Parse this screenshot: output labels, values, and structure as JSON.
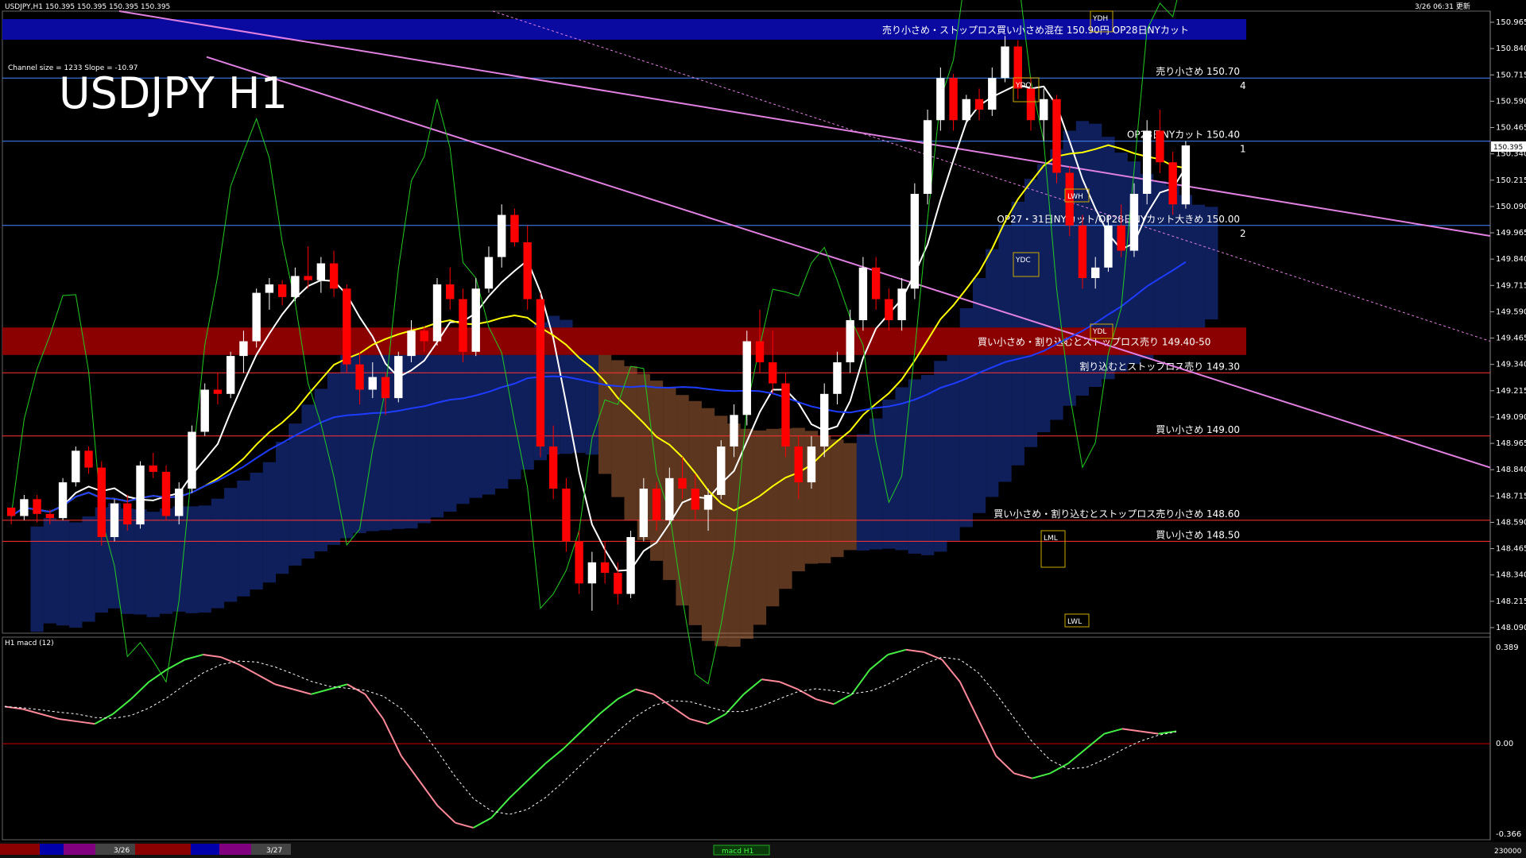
{
  "header": {
    "symbol_info": "USDJPY,H1   150.395 150.395 150.395 150.395",
    "timestamp": "3/26 06:31 更新",
    "channel_info": "Channel size = 1233 Slope = -10.97",
    "chart_title": "USDJPY H1"
  },
  "current_price": "150.395",
  "indicator_label": "H1  macd (12)",
  "bottom_tabs": [
    "3/26",
    "3/27"
  ],
  "bottom_status": "macd H1",
  "bottom_right_value": "230000",
  "colors": {
    "background": "#000000",
    "bull": "#ffffff",
    "bear": "#ff0000",
    "ma_fast": "#ffffff",
    "ma_mid": "#ffff00",
    "ma_slow": "#1e3cff",
    "chikou": "#22cc22",
    "channel": "#e080e0",
    "cloud_bull": "#2244cc",
    "cloud_bear": "#cc7744"
  },
  "chart_data": {
    "type": "candlestick",
    "title": "USDJPY H1",
    "ylim": [
      148.09,
      150.965
    ],
    "y_ticks": [
      "150.965",
      "150.840",
      "150.715",
      "150.590",
      "150.465",
      "150.340",
      "150.215",
      "150.090",
      "149.965",
      "149.840",
      "149.715",
      "149.590",
      "149.465",
      "149.340",
      "149.215",
      "149.090",
      "148.965",
      "148.840",
      "148.715",
      "148.590",
      "148.465",
      "148.340",
      "148.215",
      "148.090"
    ],
    "macd_ticks": [
      "0.389",
      "0.00",
      "-0.366"
    ],
    "candles": [
      [
        148.66,
        148.66,
        148.58,
        148.62
      ],
      [
        148.62,
        148.72,
        148.6,
        148.7
      ],
      [
        148.7,
        148.72,
        148.59,
        148.63
      ],
      [
        148.63,
        148.65,
        148.58,
        148.61
      ],
      [
        148.61,
        148.8,
        148.6,
        148.78
      ],
      [
        148.78,
        148.95,
        148.76,
        148.93
      ],
      [
        148.93,
        148.95,
        148.82,
        148.85
      ],
      [
        148.85,
        148.88,
        148.48,
        148.52
      ],
      [
        148.52,
        148.7,
        148.5,
        148.68
      ],
      [
        148.68,
        148.72,
        148.55,
        148.58
      ],
      [
        148.58,
        148.88,
        148.56,
        148.86
      ],
      [
        148.86,
        148.92,
        148.8,
        148.83
      ],
      [
        148.83,
        148.86,
        148.6,
        148.62
      ],
      [
        148.62,
        148.78,
        148.58,
        148.75
      ],
      [
        148.75,
        149.05,
        148.73,
        149.02
      ],
      [
        149.02,
        149.25,
        149.0,
        149.22
      ],
      [
        149.22,
        149.3,
        149.15,
        149.2
      ],
      [
        149.2,
        149.4,
        149.18,
        149.38
      ],
      [
        149.38,
        149.5,
        149.3,
        149.45
      ],
      [
        149.45,
        149.7,
        149.42,
        149.68
      ],
      [
        149.68,
        149.75,
        149.6,
        149.72
      ],
      [
        149.72,
        149.74,
        149.62,
        149.66
      ],
      [
        149.66,
        149.8,
        149.64,
        149.76
      ],
      [
        149.76,
        149.9,
        149.7,
        149.74
      ],
      [
        149.74,
        149.85,
        149.68,
        149.82
      ],
      [
        149.82,
        149.88,
        149.66,
        149.7
      ],
      [
        149.7,
        149.72,
        149.3,
        149.34
      ],
      [
        149.34,
        149.4,
        149.15,
        149.22
      ],
      [
        149.22,
        149.35,
        149.18,
        149.28
      ],
      [
        149.28,
        149.3,
        149.1,
        149.18
      ],
      [
        149.18,
        149.4,
        149.16,
        149.38
      ],
      [
        149.38,
        149.55,
        149.35,
        149.5
      ],
      [
        149.5,
        149.52,
        149.4,
        149.45
      ],
      [
        149.45,
        149.75,
        149.43,
        149.72
      ],
      [
        149.72,
        149.8,
        149.6,
        149.65
      ],
      [
        149.65,
        149.7,
        149.35,
        149.4
      ],
      [
        149.4,
        149.75,
        149.38,
        149.7
      ],
      [
        149.7,
        149.9,
        149.68,
        149.85
      ],
      [
        149.85,
        150.1,
        149.8,
        150.05
      ],
      [
        150.05,
        150.08,
        149.9,
        149.92
      ],
      [
        149.92,
        150.0,
        149.6,
        149.65
      ],
      [
        149.65,
        149.68,
        148.9,
        148.95
      ],
      [
        148.95,
        149.05,
        148.7,
        148.75
      ],
      [
        148.75,
        148.8,
        148.45,
        148.5
      ],
      [
        148.5,
        148.55,
        148.25,
        148.3
      ],
      [
        148.3,
        148.45,
        148.17,
        148.4
      ],
      [
        148.4,
        148.5,
        148.3,
        148.35
      ],
      [
        148.35,
        148.4,
        148.2,
        148.25
      ],
      [
        148.25,
        148.55,
        148.23,
        148.52
      ],
      [
        148.52,
        148.8,
        148.5,
        148.75
      ],
      [
        148.75,
        148.78,
        148.55,
        148.6
      ],
      [
        148.6,
        148.85,
        148.58,
        148.8
      ],
      [
        148.8,
        148.9,
        148.7,
        148.75
      ],
      [
        148.75,
        148.82,
        148.6,
        148.65
      ],
      [
        148.65,
        148.75,
        148.55,
        148.72
      ],
      [
        148.72,
        148.98,
        148.7,
        148.95
      ],
      [
        148.95,
        149.15,
        148.9,
        149.1
      ],
      [
        149.1,
        149.5,
        149.05,
        149.45
      ],
      [
        149.45,
        149.6,
        149.3,
        149.35
      ],
      [
        149.35,
        149.5,
        149.2,
        149.25
      ],
      [
        149.25,
        149.3,
        148.9,
        148.95
      ],
      [
        148.95,
        149.0,
        148.7,
        148.78
      ],
      [
        148.78,
        149.0,
        148.75,
        148.95
      ],
      [
        148.95,
        149.25,
        148.9,
        149.2
      ],
      [
        149.2,
        149.4,
        149.15,
        149.35
      ],
      [
        149.35,
        149.6,
        149.3,
        149.55
      ],
      [
        149.55,
        149.85,
        149.5,
        149.8
      ],
      [
        149.8,
        149.85,
        149.6,
        149.65
      ],
      [
        149.65,
        149.7,
        149.5,
        149.55
      ],
      [
        149.55,
        149.75,
        149.5,
        149.7
      ],
      [
        149.7,
        150.2,
        149.65,
        150.15
      ],
      [
        150.15,
        150.55,
        150.1,
        150.5
      ],
      [
        150.5,
        150.75,
        150.45,
        150.7
      ],
      [
        150.7,
        150.72,
        150.45,
        150.5
      ],
      [
        150.5,
        150.62,
        150.48,
        150.6
      ],
      [
        150.6,
        150.65,
        150.5,
        150.55
      ],
      [
        150.55,
        150.75,
        150.52,
        150.7
      ],
      [
        150.7,
        150.9,
        150.68,
        150.85
      ],
      [
        150.85,
        150.88,
        150.6,
        150.65
      ],
      [
        150.65,
        150.7,
        150.45,
        150.5
      ],
      [
        150.5,
        150.65,
        150.4,
        150.6
      ],
      [
        150.6,
        150.62,
        150.2,
        150.25
      ],
      [
        150.25,
        150.28,
        149.95,
        150.0
      ],
      [
        150.0,
        150.05,
        149.7,
        149.75
      ],
      [
        149.75,
        149.85,
        149.7,
        149.8
      ],
      [
        149.8,
        150.05,
        149.78,
        150.0
      ],
      [
        150.0,
        150.1,
        149.85,
        149.88
      ],
      [
        149.88,
        150.2,
        149.85,
        150.15
      ],
      [
        150.15,
        150.5,
        150.1,
        150.45
      ],
      [
        150.45,
        150.55,
        150.25,
        150.3
      ],
      [
        150.3,
        150.35,
        150.05,
        150.1
      ],
      [
        150.1,
        150.4,
        150.08,
        150.38
      ]
    ],
    "levels": [
      {
        "price": 150.7,
        "label": "売り小さめ 150.70",
        "color": "#4488ff",
        "num": "4"
      },
      {
        "price": 150.4,
        "label": "OP28日NYカット 150.40",
        "color": "#4488ff",
        "num": "1"
      },
      {
        "price": 150.0,
        "label": "OP27・31日NYカット/OP28日NYカット大きめ 150.00",
        "color": "#4488ff",
        "num": "2"
      },
      {
        "price": 149.3,
        "label": "割り込むとストップロス売り 149.30",
        "color": "#ff3333"
      },
      {
        "price": 149.0,
        "label": "買い小さめ 149.00",
        "color": "#ff3333"
      },
      {
        "price": 148.6,
        "label": "買い小さめ・割り込むとストップロス売り小さめ 148.60",
        "color": "#ff3333"
      },
      {
        "price": 148.5,
        "label": "買い小さめ 148.50",
        "color": "#ff3333"
      }
    ],
    "top_band": {
      "label": "売り小さめ・ストップロス買い小さめ混在 150.90円 OP28日NYカット",
      "color": "#0a0aa0"
    },
    "mid_band": {
      "label": "買い小さめ・割り込むとストップロス売り 149.40-50",
      "color": "#8b0000",
      "top": 149.5,
      "bottom": 149.4
    },
    "box_labels": [
      "YDH",
      "YDO",
      "YDC",
      "YDL",
      "LML",
      "LWL",
      "LWH"
    ],
    "macd": [
      0.15,
      0.14,
      0.12,
      0.1,
      0.09,
      0.08,
      0.12,
      0.18,
      0.25,
      0.3,
      0.34,
      0.36,
      0.35,
      0.32,
      0.28,
      0.24,
      0.22,
      0.2,
      0.22,
      0.24,
      0.2,
      0.1,
      -0.05,
      -0.15,
      -0.25,
      -0.32,
      -0.34,
      -0.3,
      -0.22,
      -0.15,
      -0.08,
      -0.02,
      0.05,
      0.12,
      0.18,
      0.22,
      0.2,
      0.15,
      0.1,
      0.08,
      0.12,
      0.2,
      0.26,
      0.25,
      0.22,
      0.18,
      0.16,
      0.2,
      0.3,
      0.36,
      0.38,
      0.37,
      0.34,
      0.25,
      0.1,
      -0.05,
      -0.12,
      -0.14,
      -0.12,
      -0.08,
      -0.02,
      0.04,
      0.06,
      0.05,
      0.04,
      0.05
    ]
  }
}
